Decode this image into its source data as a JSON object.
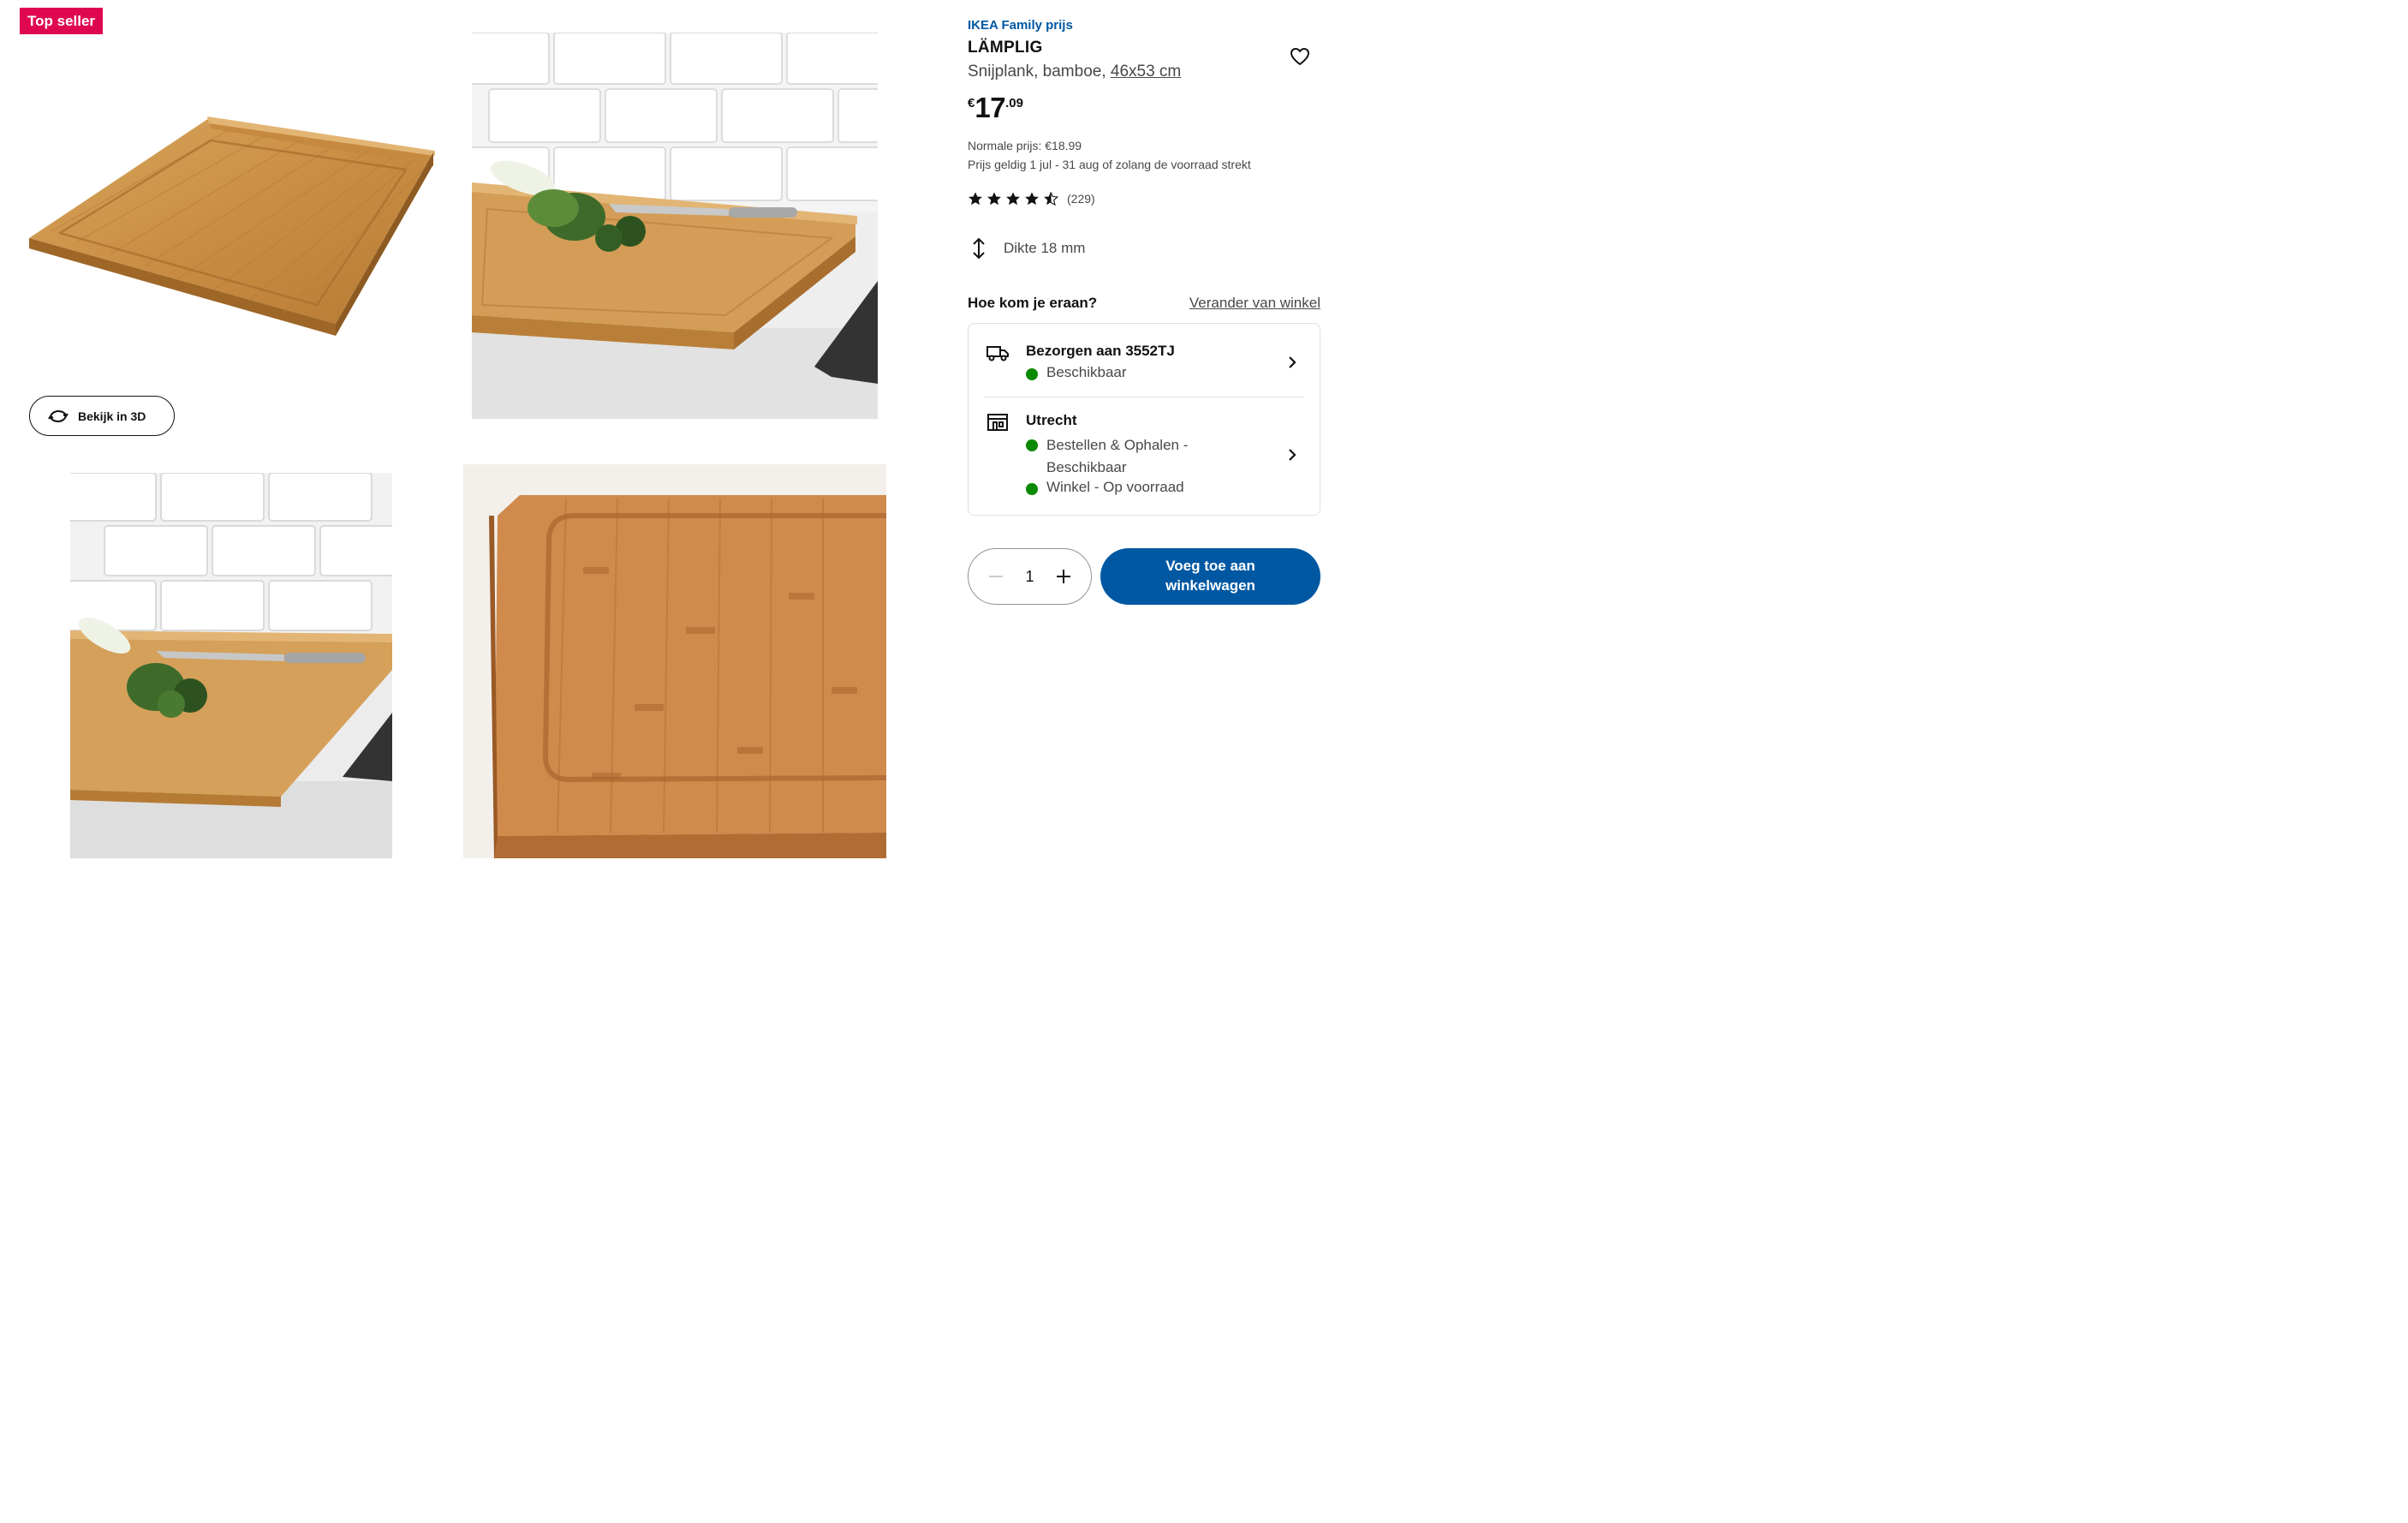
{
  "gallery": {
    "badge": "Top seller",
    "view3d_label": "Bekijk in 3D",
    "images": [
      {
        "alt": "cutting-board-product-image"
      },
      {
        "alt": "cutting-board-kitchen-leek-knife"
      },
      {
        "alt": "cutting-board-countertop-leek-knife"
      },
      {
        "alt": "cutting-board-closeup-groove"
      }
    ]
  },
  "product": {
    "family_label": "IKEA Family prijs",
    "name": "LÄMPLIG",
    "desc_prefix": "Snijplank, bamboe, ",
    "size_link": "46x53 cm",
    "price": {
      "currency": "€",
      "integer": "17",
      "decimal": ".09"
    },
    "normal_price": "Normale prijs: €18.99",
    "validity": "Prijs geldig 1 jul - 31 aug of zolang de voorraad strekt",
    "rating": {
      "stars": 4.5,
      "count": "(229)"
    },
    "thickness": "Dikte 18 mm"
  },
  "availability": {
    "heading": "Hoe kom je eraan?",
    "change_store": "Verander van winkel",
    "delivery": {
      "title": "Bezorgen aan 3552TJ",
      "status": "Beschikbaar"
    },
    "store": {
      "title": "Utrecht",
      "status1": "Bestellen & Ophalen - Beschikbaar",
      "status2": "Winkel - Op voorraad"
    }
  },
  "purchase": {
    "quantity": "1",
    "add_to_cart": "Voeg toe aan winkelwagen"
  },
  "colors": {
    "brand_blue": "#0058a3",
    "badge_red": "#e00751",
    "available_green": "#0a8a00"
  }
}
